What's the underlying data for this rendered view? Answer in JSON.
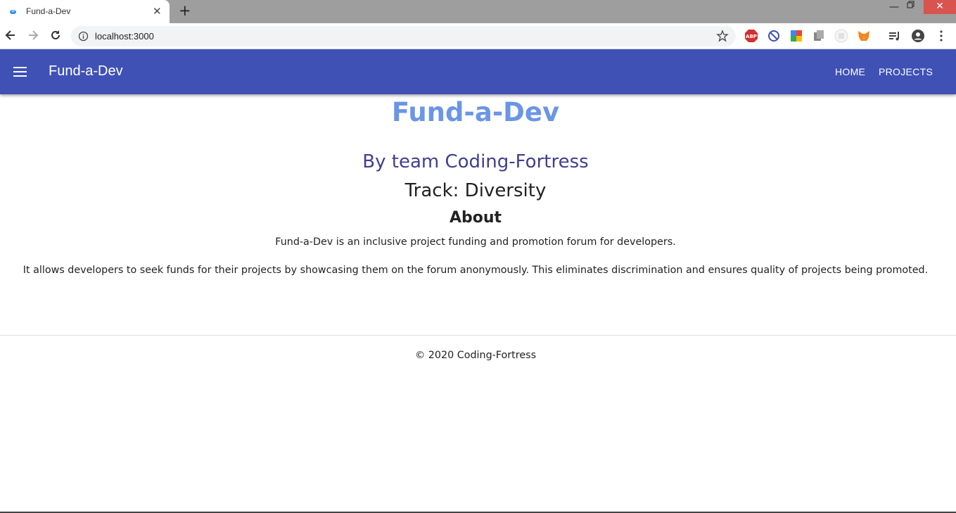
{
  "browser": {
    "tab_title": "Fund-a-Dev",
    "url": "localhost:3000",
    "icons": [
      "back-icon",
      "forward-icon",
      "reload-icon",
      "info-icon",
      "star-icon",
      "adblock-icon",
      "block-icon",
      "google-icon",
      "extension-icon",
      "extension-icon",
      "metamask-icon",
      "media-icon",
      "profile-icon",
      "more-icon"
    ]
  },
  "appbar": {
    "title": "Fund-a-Dev",
    "links": [
      "HOME",
      "PROJECTS"
    ],
    "color": "#3f51b5"
  },
  "main": {
    "hero_title": "Fund-a-Dev",
    "team": "By team Coding-Fortress",
    "track": "Track: Diversity",
    "about_heading": "About",
    "paragraph1": "Fund-a-Dev is an inclusive project funding and promotion forum for developers.",
    "paragraph2": "It allows developers to seek funds for their projects by showcasing them on the forum anonymously. This eliminates discrimination and ensures quality of projects being promoted.",
    "hero_color": "#6b96e6",
    "team_color": "#3f3f8f"
  },
  "footer": {
    "text": "© 2020 Coding-Fortress"
  }
}
